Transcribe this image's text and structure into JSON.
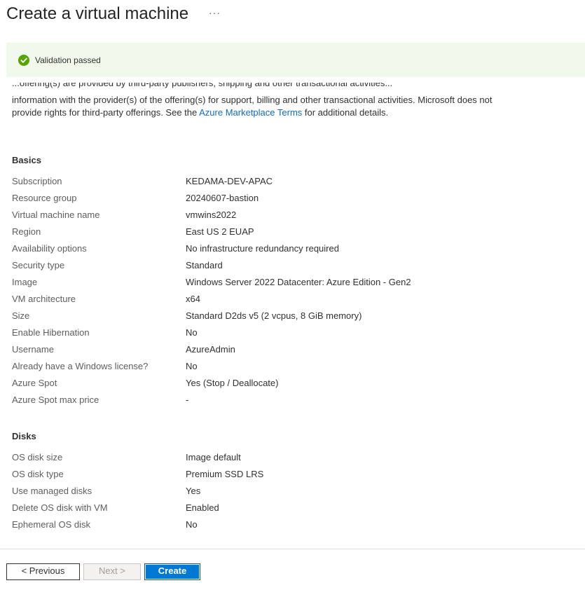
{
  "page": {
    "title": "Create a virtual machine",
    "more_label": "···"
  },
  "banner": {
    "message": "Validation passed"
  },
  "terms": {
    "clipped_line": "...offering(s) are provided by third-party publishers; shipping and other transactional activities...",
    "text_before_link": "information with the provider(s) of the offering(s) for support, billing and other transactional activities. Microsoft does not provide rights for third-party offerings. See the ",
    "link_text": "Azure Marketplace Terms",
    "text_after_link": " for additional details."
  },
  "basics": {
    "title": "Basics",
    "rows": [
      {
        "label": "Subscription",
        "value": "KEDAMA-DEV-APAC"
      },
      {
        "label": "Resource group",
        "value": "20240607-bastion"
      },
      {
        "label": "Virtual machine name",
        "value": "vmwins2022"
      },
      {
        "label": "Region",
        "value": "East US 2 EUAP"
      },
      {
        "label": "Availability options",
        "value": "No infrastructure redundancy required"
      },
      {
        "label": "Security type",
        "value": "Standard"
      },
      {
        "label": "Image",
        "value": "Windows Server 2022 Datacenter: Azure Edition - Gen2"
      },
      {
        "label": "VM architecture",
        "value": "x64"
      },
      {
        "label": "Size",
        "value": "Standard D2ds v5 (2 vcpus, 8 GiB memory)"
      },
      {
        "label": "Enable Hibernation",
        "value": "No"
      },
      {
        "label": "Username",
        "value": "AzureAdmin"
      },
      {
        "label": "Already have a Windows license?",
        "value": "No"
      },
      {
        "label": "Azure Spot",
        "value": "Yes (Stop / Deallocate)"
      },
      {
        "label": "Azure Spot max price",
        "value": "-"
      }
    ]
  },
  "disks": {
    "title": "Disks",
    "rows": [
      {
        "label": "OS disk size",
        "value": "Image default"
      },
      {
        "label": "OS disk type",
        "value": "Premium SSD LRS"
      },
      {
        "label": "Use managed disks",
        "value": "Yes"
      },
      {
        "label": "Delete OS disk with VM",
        "value": "Enabled"
      },
      {
        "label": "Ephemeral OS disk",
        "value": "No"
      }
    ]
  },
  "footer": {
    "previous_label": "< Previous",
    "next_label": "Next >",
    "create_label": "Create"
  },
  "colors": {
    "accent": "#0078d4",
    "link": "#0f6cbd",
    "success": "#57a300",
    "banner_bg": "#f1f8ec"
  }
}
